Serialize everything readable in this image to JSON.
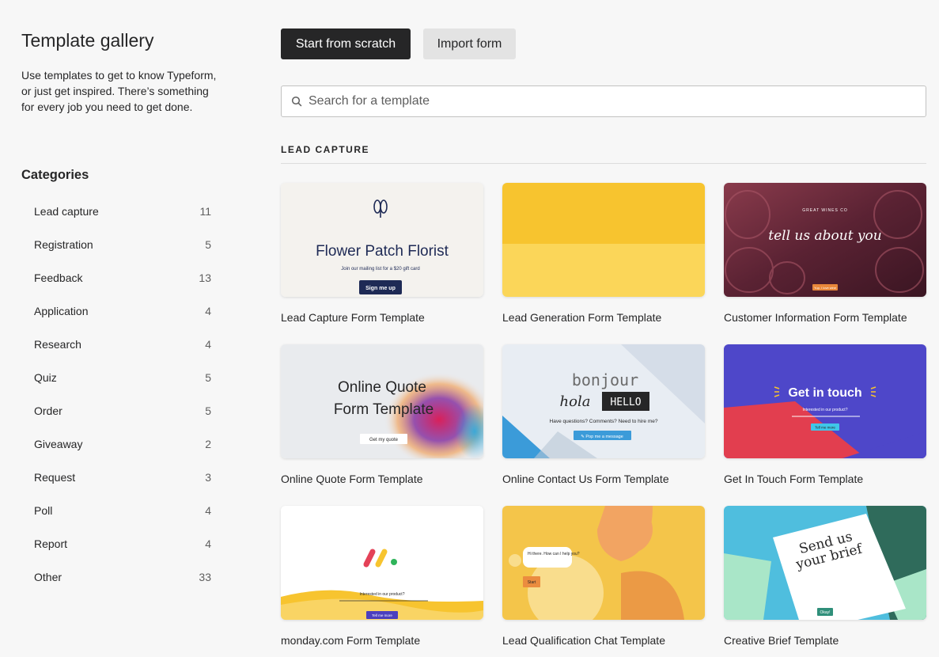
{
  "sidebar": {
    "title": "Template gallery",
    "description": "Use templates to get to know Typeform, or just get inspired. There’s something for every job you need to get done.",
    "categories_title": "Categories",
    "categories": [
      {
        "label": "Lead capture",
        "count": "11"
      },
      {
        "label": "Registration",
        "count": "5"
      },
      {
        "label": "Feedback",
        "count": "13"
      },
      {
        "label": "Application",
        "count": "4"
      },
      {
        "label": "Research",
        "count": "4"
      },
      {
        "label": "Quiz",
        "count": "5"
      },
      {
        "label": "Order",
        "count": "5"
      },
      {
        "label": "Giveaway",
        "count": "2"
      },
      {
        "label": "Request",
        "count": "3"
      },
      {
        "label": "Poll",
        "count": "4"
      },
      {
        "label": "Report",
        "count": "4"
      },
      {
        "label": "Other",
        "count": "33"
      }
    ]
  },
  "toolbar": {
    "start_label": "Start from scratch",
    "import_label": "Import form"
  },
  "search": {
    "placeholder": "Search for a template",
    "icon": "search-icon"
  },
  "section": {
    "title": "LEAD CAPTURE"
  },
  "templates": [
    {
      "label": "Lead Capture Form Template",
      "thumb_title": "Flower Patch Florist",
      "thumb_sub": "Join our mailing list for a $20 gift card",
      "thumb_button": "Sign me up"
    },
    {
      "label": "Lead Generation Form Template"
    },
    {
      "label": "Customer Information Form Template",
      "thumb_pre": "GREAT WINES CO",
      "thumb_title": "tell us about you",
      "thumb_button": "Yup, I love wine"
    },
    {
      "label": "Online Quote Form Template",
      "thumb_title_1": "Online Quote",
      "thumb_title_2": "Form Template",
      "thumb_button": "Get my quote"
    },
    {
      "label": "Online Contact Us Form Template",
      "thumb_w1": "bonjour",
      "thumb_w2": "hola",
      "thumb_w3": "HELLO",
      "thumb_sub": "Have questions? Comments? Need to hire me?",
      "thumb_button": "✎ Pop me a message"
    },
    {
      "label": "Get In Touch Form Template",
      "thumb_title": "Get in touch",
      "thumb_sub": "Interested in our product?",
      "thumb_button": "Tell me more"
    },
    {
      "label": "monday.com Form Template",
      "thumb_sub": "Interested in our product?",
      "thumb_button": "Tell me more"
    },
    {
      "label": "Lead Qualification Chat Template",
      "thumb_bubble": "Hi there. How can I help you?",
      "thumb_button": "Start"
    },
    {
      "label": "Creative Brief Template",
      "thumb_title_1": "Send us",
      "thumb_title_2": "your brief",
      "thumb_button": "Okay!"
    }
  ],
  "colors": {
    "primary_button": "#262627",
    "secondary_button": "#e3e3e3",
    "background": "#f7f7f7"
  }
}
